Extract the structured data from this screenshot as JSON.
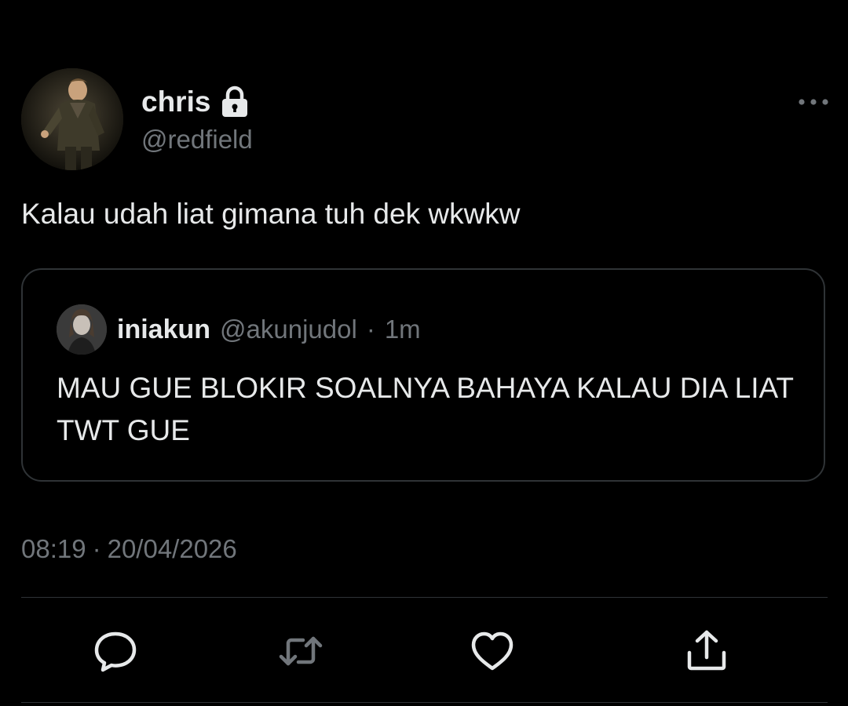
{
  "author": {
    "display_name": "chris",
    "handle": "@redfield",
    "protected_icon": "lock-icon",
    "avatar_icon": "avatar"
  },
  "tweet": {
    "text": "Kalau udah liat gimana tuh dek wkwkw",
    "more_icon": "more-horizontal-icon"
  },
  "quoted_tweet": {
    "display_name": "iniakun",
    "handle": "@akunjudol",
    "separator": "·",
    "time": "1m",
    "text": "MAU GUE BLOKIR SOALNYA BAHAYA KALAU DIA LIAT TWT GUE"
  },
  "meta": {
    "time": "08:19",
    "separator": "·",
    "date": "20/04/2026"
  },
  "actions": [
    {
      "icon": "reply-icon"
    },
    {
      "icon": "retweet-icon"
    },
    {
      "icon": "like-icon"
    },
    {
      "icon": "share-icon"
    }
  ],
  "colors": {
    "background": "#000000",
    "text_primary": "#e7e9ea",
    "text_secondary": "#71767b",
    "border": "#2f3336"
  }
}
